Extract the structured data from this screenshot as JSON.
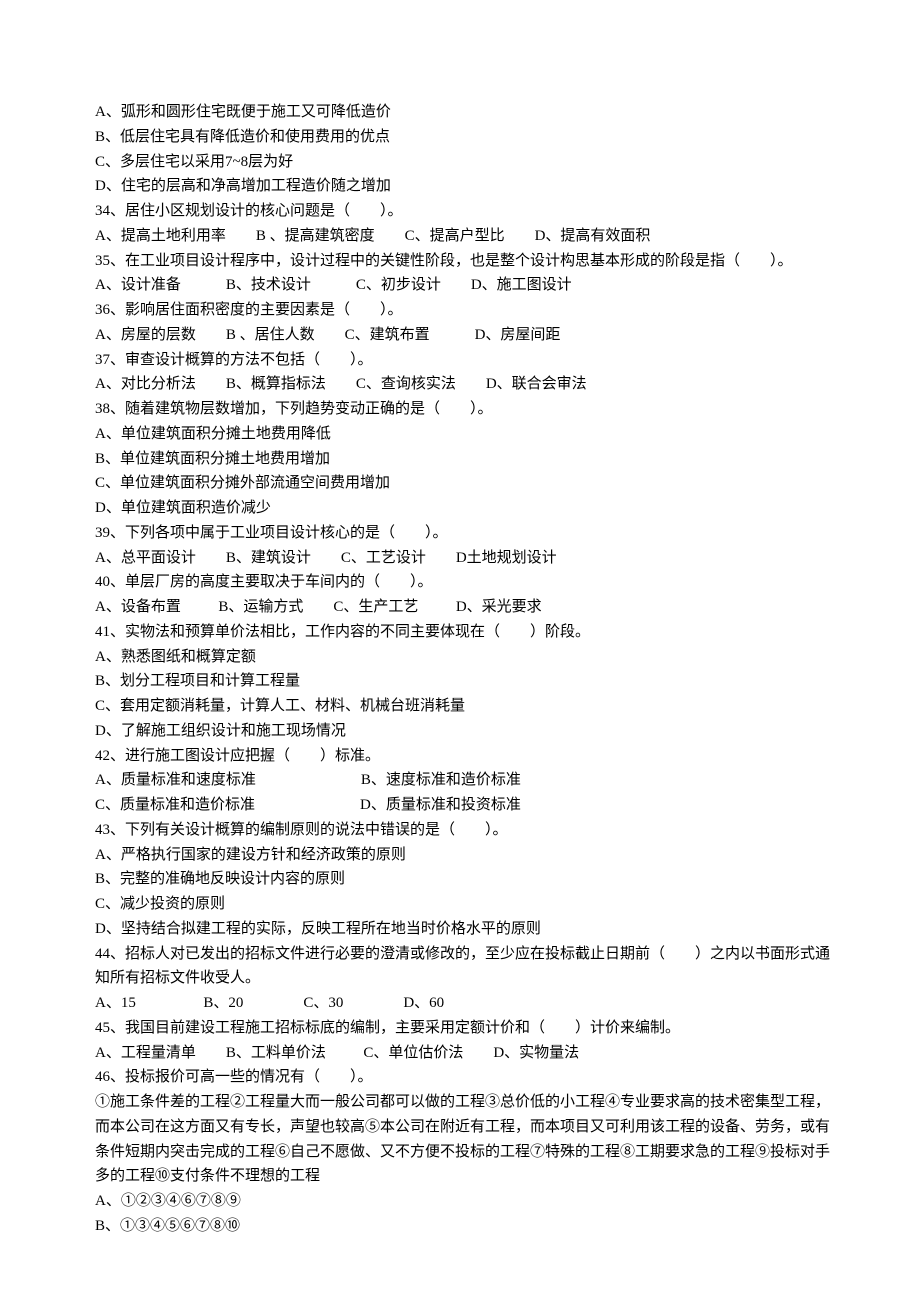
{
  "lines": [
    "A、弧形和圆形住宅既便于施工又可降低造价",
    "B、低层住宅具有降低造价和使用费用的优点",
    "C、多层住宅以采用7~8层为好",
    "D、住宅的层高和净高增加工程造价随之增加",
    "34、居住小区规划设计的核心问题是（        ）。",
    "A、提高土地利用率        B 、提高建筑密度        C、提高户型比        D、提高有效面积",
    "35、在工业项目设计程序中，设计过程中的关键性阶段，也是整个设计构思基本形成的阶段是指（        ）。",
    "A、设计准备            B、技术设计            C、初步设计        D、施工图设计",
    "36、影响居住面积密度的主要因素是（        ）。",
    "A、房屋的层数        B 、居住人数        C、建筑布置            D、房屋间距",
    "37、审查设计概算的方法不包括（        ）。",
    "A、对比分析法        B、概算指标法        C、查询核实法        D、联合会审法",
    "38、随着建筑物层数增加，下列趋势变动正确的是（        ）。",
    "A、单位建筑面积分摊土地费用降低",
    "B、单位建筑面积分摊土地费用增加",
    "C、单位建筑面积分摊外部流通空间费用增加",
    "D、单位建筑面积造价减少",
    "39、下列各项中属于工业项目设计核心的是（        ）。",
    "A、总平面设计        B、建筑设计        C、工艺设计        D土地规划设计",
    "40、单层厂房的高度主要取决于车间内的（        ）。",
    "A、设备布置          B、运输方式        C、生产工艺          D、采光要求",
    "41、实物法和预算单价法相比，工作内容的不同主要体现在（        ）阶段。",
    "A、熟悉图纸和概算定额",
    "B、划分工程项目和计算工程量",
    "C、套用定额消耗量，计算人工、材料、机械台班消耗量",
    "D、了解施工组织设计和施工现场情况",
    "42、进行施工图设计应把握（        ）标准。",
    "A、质量标准和速度标准                            B、速度标准和造价标准",
    "C、质量标准和造价标准                            D、质量标准和投资标准",
    "43、下列有关设计概算的编制原则的说法中错误的是（        ）。",
    "A、严格执行国家的建设方针和经济政策的原则",
    "B、完整的准确地反映设计内容的原则",
    "C、减少投资的原则",
    "D、坚持结合拟建工程的实际，反映工程所在地当时价格水平的原则",
    "44、招标人对已发出的招标文件进行必要的澄清或修改的，至少应在投标截止日期前（        ）之内以书面形式通知所有招标文件收受人。",
    "A、15                  B、20                C、30                D、60",
    "45、我国目前建设工程施工招标标底的编制，主要采用定额计价和（        ）计价来编制。",
    "A、工程量清单        B、工料单价法          C、单位估价法        D、实物量法",
    "46、投标报价可高一些的情况有（        ）。",
    "①施工条件差的工程②工程量大而一般公司都可以做的工程③总价低的小工程④专业要求高的技术密集型工程，而本公司在这方面又有专长，声望也较高⑤本公司在附近有工程，而本项目又可利用该工程的设备、劳务，或有条件短期内突击完成的工程⑥自己不愿做、又不方便不投标的工程⑦特殊的工程⑧工期要求急的工程⑨投标对手多的工程⑩支付条件不理想的工程",
    "A、①②③④⑥⑦⑧⑨",
    "B、①③④⑤⑥⑦⑧⑩"
  ]
}
